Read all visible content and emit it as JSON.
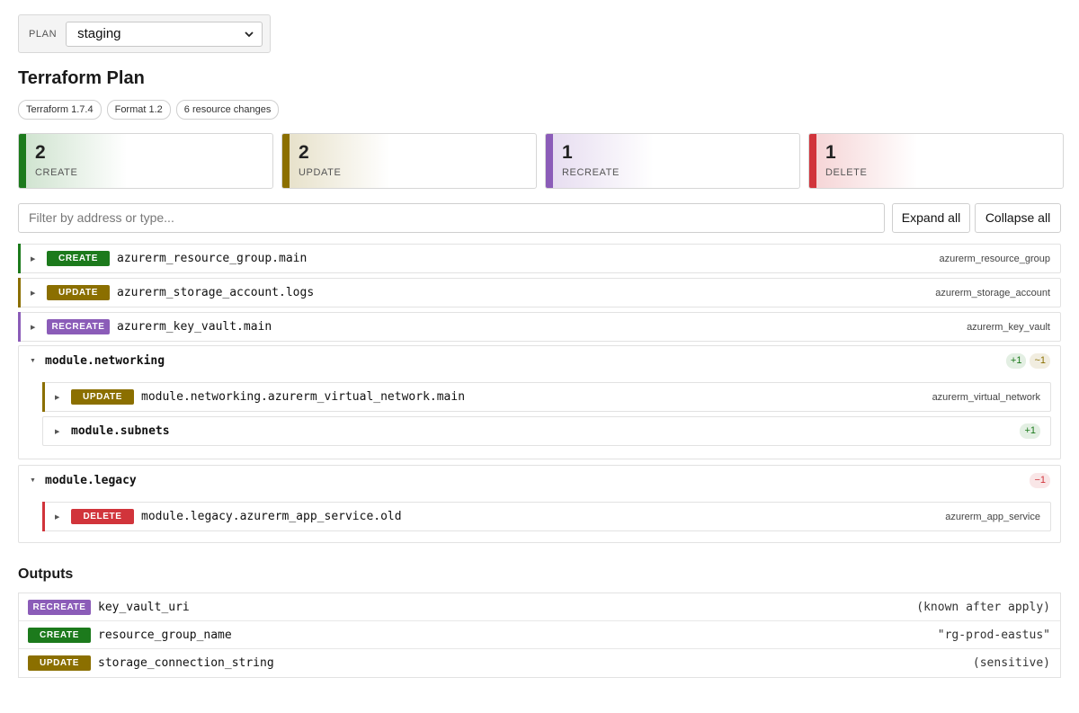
{
  "plan": {
    "label": "PLAN",
    "selected": "staging"
  },
  "title": "Terraform Plan",
  "pills": [
    "Terraform 1.7.4",
    "Format 1.2",
    "6 resource changes"
  ],
  "colors": {
    "create": "#1c7a1c",
    "update": "#8b6f00",
    "recreate": "#8b5cb8",
    "delete": "#d1343b"
  },
  "summary": [
    {
      "count": "2",
      "label": "CREATE",
      "kind": "create"
    },
    {
      "count": "2",
      "label": "UPDATE",
      "kind": "update"
    },
    {
      "count": "1",
      "label": "RECREATE",
      "kind": "recreate"
    },
    {
      "count": "1",
      "label": "DELETE",
      "kind": "delete"
    }
  ],
  "filter": {
    "placeholder": "Filter by address or type..."
  },
  "buttons": {
    "expand_all": "Expand all",
    "collapse_all": "Collapse all"
  },
  "resources": [
    {
      "action": "CREATE",
      "kind": "create",
      "address": "azurerm_resource_group.main",
      "type": "azurerm_resource_group"
    },
    {
      "action": "UPDATE",
      "kind": "update",
      "address": "azurerm_storage_account.logs",
      "type": "azurerm_storage_account"
    },
    {
      "action": "RECREATE",
      "kind": "recreate",
      "address": "azurerm_key_vault.main",
      "type": "azurerm_key_vault"
    }
  ],
  "modules": [
    {
      "name": "module.networking",
      "counts": [
        "+1",
        "~1"
      ],
      "children": [
        {
          "action": "UPDATE",
          "kind": "update",
          "address": "module.networking.azurerm_virtual_network.main",
          "type": "azurerm_virtual_network"
        }
      ],
      "submodules": [
        {
          "name": "module.subnets",
          "counts": [
            "+1"
          ]
        }
      ]
    },
    {
      "name": "module.legacy",
      "counts": [
        "−1"
      ],
      "children": [
        {
          "action": "DELETE",
          "kind": "delete",
          "address": "module.legacy.azurerm_app_service.old",
          "type": "azurerm_app_service"
        }
      ]
    }
  ],
  "outputs_title": "Outputs",
  "outputs": [
    {
      "action": "RECREATE",
      "kind": "recreate",
      "name": "key_vault_uri",
      "value": "(known after apply)"
    },
    {
      "action": "CREATE",
      "kind": "create",
      "name": "resource_group_name",
      "value": "\"rg-prod-eastus\""
    },
    {
      "action": "UPDATE",
      "kind": "update",
      "name": "storage_connection_string",
      "value": "(sensitive)"
    }
  ]
}
